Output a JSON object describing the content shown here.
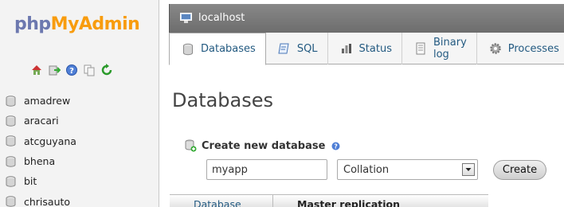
{
  "nav": {
    "logo": {
      "php": "php",
      "my": "My",
      "admin": "Admin"
    },
    "quick_icons": [
      "home-icon",
      "logout-icon",
      "help-icon",
      "copy-icon",
      "reload-icon"
    ],
    "databases": [
      "amadrew",
      "aracari",
      "atcguyana",
      "bhena",
      "bit",
      "chrisauto"
    ]
  },
  "server_bar": {
    "label": "localhost"
  },
  "tabs": [
    {
      "label": "Databases",
      "icon": "database-icon",
      "active": true
    },
    {
      "label": "SQL",
      "icon": "sql-icon",
      "active": false
    },
    {
      "label": "Status",
      "icon": "status-icon",
      "active": false
    },
    {
      "label": "Binary log",
      "icon": "binary-log-icon",
      "active": false
    },
    {
      "label": "Processes",
      "icon": "gear-icon",
      "active": false
    }
  ],
  "main": {
    "title": "Databases",
    "create_label": "Create new database",
    "dbname_value": "myapp",
    "collation_selected": "Collation",
    "create_button": "Create",
    "table_headers": {
      "database": "Database",
      "replication": "Master replication"
    }
  },
  "colors": {
    "link": "#235a81",
    "logo_blue": "#6c78af",
    "logo_orange": "#f89c0e",
    "server_bar": "#7a7a7a"
  }
}
